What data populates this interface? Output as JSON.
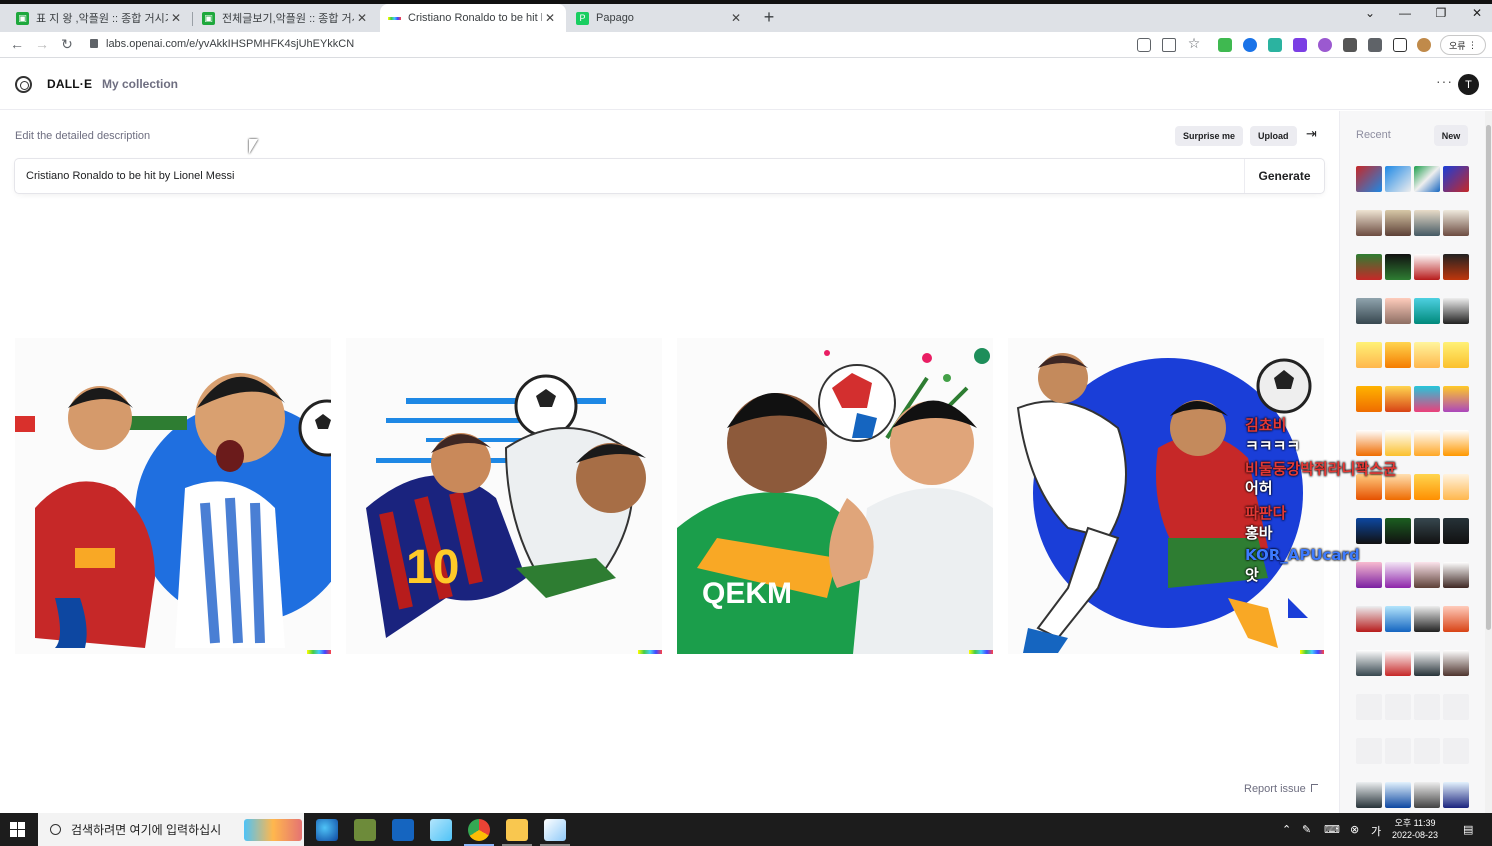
{
  "browser": {
    "tabs": [
      {
        "title": "표 지 왕 ,악플원 :: 종합 거시기 ::",
        "favicon_color": "#1ea83c"
      },
      {
        "title": "전체글보기,악플원 :: 종합 거시기 ::",
        "favicon_color": "#1ea83c"
      },
      {
        "title": "Cristiano Ronaldo to be hit by Lio",
        "favicon_color": "#5b8def"
      },
      {
        "title": "Papago",
        "favicon_color": "#19ce60"
      }
    ],
    "url": "labs.openai.com/e/yvAkkIHSPMHFK4sjUhEYkkCN",
    "profile_label": "오류"
  },
  "app": {
    "brand": "DALL·E",
    "nav_collection": "My collection",
    "avatar_letter": "T",
    "prompt_label": "Edit the detailed description",
    "surprise_label": "Surprise me",
    "upload_label": "Upload",
    "prompt_value": "Cristiano Ronaldo to be hit by Lionel Messi",
    "generate_label": "Generate",
    "report_label": "Report issue"
  },
  "sidebar": {
    "recent_label": "Recent",
    "new_label": "New"
  },
  "overlay": {
    "lines": [
      "김쵸비",
      "ㅋㅋㅋㅋ",
      "비둘둥강박쥐라니꽉스균",
      "어허",
      "파판다",
      "홍바",
      "KOR_APUcard",
      "앗"
    ]
  },
  "taskbar": {
    "search_placeholder": "검색하려면 여기에 입력하십시",
    "time": "오후 11:39",
    "date": "2022-08-23"
  },
  "colors": {
    "accent": "#10a37f",
    "sidebar_bg": "#f7f7f8",
    "taskbar_bg": "#1c1c1c"
  }
}
